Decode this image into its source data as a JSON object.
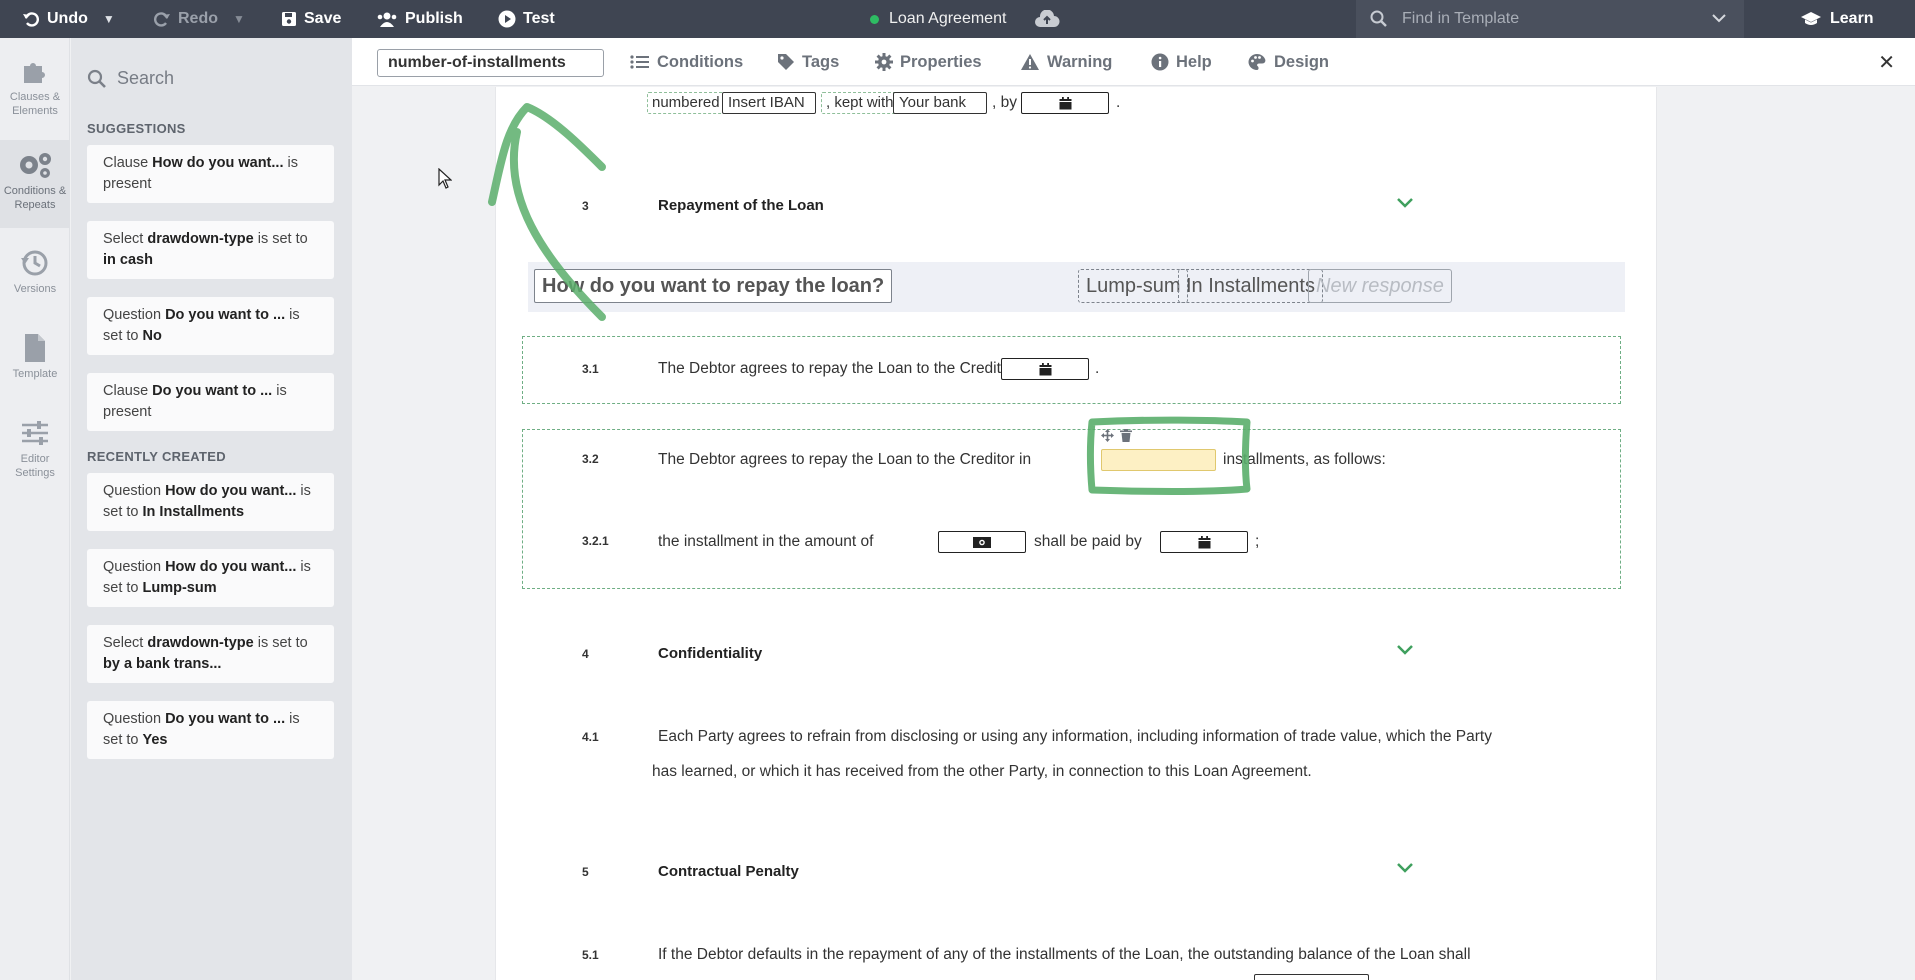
{
  "topbar": {
    "undo": "Undo",
    "redo": "Redo",
    "save": "Save",
    "publish": "Publish",
    "test": "Test",
    "doc_title": "Loan Agreement",
    "find_placeholder": "Find in Template",
    "learn": "Learn",
    "status_color": "#2ebc63"
  },
  "rail": {
    "items": [
      {
        "label": "Clauses & Elements",
        "icon": "puzzle-icon"
      },
      {
        "label": "Conditions & Repeats",
        "icon": "gears-icon",
        "active": true
      },
      {
        "label": "Versions",
        "icon": "history-icon"
      },
      {
        "label": "Template",
        "icon": "file-icon"
      },
      {
        "label": "Editor Settings",
        "icon": "sliders-icon"
      }
    ]
  },
  "panel": {
    "search_placeholder": "Search",
    "suggestions_heading": "SUGGESTIONS",
    "recent_heading": "RECENTLY CREATED",
    "suggestions": [
      {
        "pre": "Clause ",
        "bold": "How do you want...",
        "mid": " is present",
        "val": ""
      },
      {
        "pre": "Select ",
        "bold": "drawdown-type",
        "mid": " is set to ",
        "val": "in cash"
      },
      {
        "pre": "Question ",
        "bold": "Do you want to ...",
        "mid": " is set to ",
        "val": "No"
      },
      {
        "pre": "Clause ",
        "bold": "Do you want to ...",
        "mid": " is present",
        "val": ""
      }
    ],
    "recent": [
      {
        "pre": "Question ",
        "bold": "How do you want...",
        "mid": " is set to ",
        "val": "In Installments"
      },
      {
        "pre": "Question ",
        "bold": "How do you want...",
        "mid": " is set to ",
        "val": "Lump-sum"
      },
      {
        "pre": "Select ",
        "bold": "drawdown-type",
        "mid": " is set to ",
        "val": "by a bank trans..."
      },
      {
        "pre": "Question ",
        "bold": "Do you want to ...",
        "mid": " is set to ",
        "val": "Yes"
      }
    ]
  },
  "editor_toolbar": {
    "variable_name": "number-of-installments",
    "conditions": "Conditions",
    "tags": "Tags",
    "properties": "Properties",
    "warning": "Warning",
    "help": "Help",
    "design": "Design",
    "close": "✕"
  },
  "document": {
    "top_line": {
      "numbered": "numbered",
      "iban": "Insert IBAN",
      "kept_with": ", kept with",
      "bank": "Your bank",
      "by": ", by",
      "period": "."
    },
    "sections": [
      {
        "num": "3",
        "title": "Repayment of the Loan"
      },
      {
        "num": "4",
        "title": "Confidentiality"
      },
      {
        "num": "5",
        "title": "Contractual Penalty"
      }
    ],
    "question": {
      "title": "How do you want to repay the loan?",
      "responses": [
        "Lump-sum",
        "In Installments"
      ],
      "new_response": "New response"
    },
    "clause_3_1": {
      "num": "3.1",
      "text": "The Debtor agrees to repay the Loan to the Creditor by",
      "end": "."
    },
    "clause_3_2": {
      "num": "3.2",
      "text": "The Debtor agrees to repay the Loan to the Creditor in",
      "end": "installments, as follows:"
    },
    "clause_3_2_1": {
      "num": "3.2.1",
      "text": "the installment in the amount of",
      "mid": "shall be paid by",
      "end": ";"
    },
    "clause_4_1": {
      "num": "4.1",
      "line1": "Each Party agrees to refrain from disclosing or using any information, including information of trade value, which the Party",
      "line2": "has learned, or which it has received from the other Party, in connection to this Loan Agreement."
    },
    "clause_5_1": {
      "num": "5.1",
      "line1": "If the Debtor defaults in the repayment   of any of the installments   of the Loan,   the outstanding balance of the Loan shall"
    }
  }
}
